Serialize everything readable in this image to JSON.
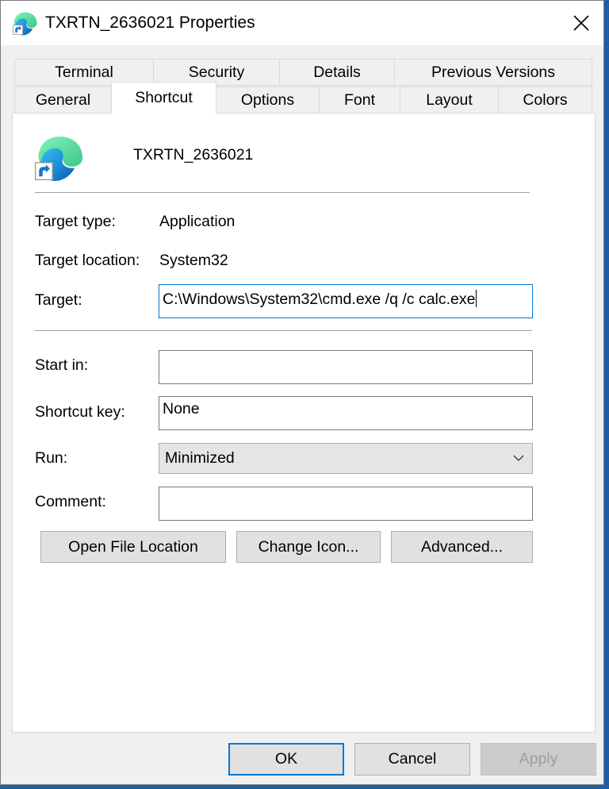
{
  "window": {
    "title": "TXRTN_2636021 Properties"
  },
  "tabs": {
    "row1": [
      {
        "label": "Terminal"
      },
      {
        "label": "Security"
      },
      {
        "label": "Details"
      },
      {
        "label": "Previous Versions"
      }
    ],
    "row2": [
      {
        "label": "General"
      },
      {
        "label": "Shortcut",
        "active": true
      },
      {
        "label": "Options"
      },
      {
        "label": "Font"
      },
      {
        "label": "Layout"
      },
      {
        "label": "Colors"
      }
    ]
  },
  "shortcut": {
    "name": "TXRTN_2636021",
    "target_type_label": "Target type:",
    "target_type_value": "Application",
    "target_location_label": "Target location:",
    "target_location_value": "System32",
    "target_label": "Target:",
    "target_value": "C:\\Windows\\System32\\cmd.exe /q /c calc.exe",
    "start_in_label": "Start in:",
    "start_in_value": "",
    "shortcut_key_label": "Shortcut key:",
    "shortcut_key_value": "None",
    "run_label": "Run:",
    "run_value": "Minimized",
    "comment_label": "Comment:",
    "comment_value": ""
  },
  "actions": {
    "open_file_location": "Open File Location",
    "change_icon": "Change Icon...",
    "advanced": "Advanced..."
  },
  "footer": {
    "ok": "OK",
    "cancel": "Cancel",
    "apply": "Apply"
  },
  "colors": {
    "accent": "#0078d7",
    "edge_blue": "#0c59a4",
    "edge_green": "#50e6a0"
  },
  "icons": {
    "title": "edge-shortcut-icon",
    "app": "edge-shortcut-icon",
    "close": "close-icon",
    "dropdown": "chevron-down-icon"
  }
}
